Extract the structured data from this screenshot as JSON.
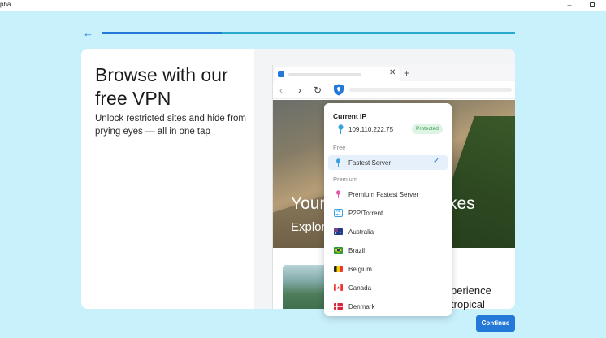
{
  "window": {
    "title": "pha"
  },
  "progress": {
    "value": 0.29
  },
  "intro": {
    "headline": "Browse with our free VPN",
    "subtext": "Unlock restricted sites and hide from prying eyes — all in one tap"
  },
  "browser_mock": {
    "hero_headline_left": "Your",
    "hero_headline_right": "kes",
    "hero_subline": "Explor",
    "snippet_line1": "perience",
    "snippet_line2": "tropical"
  },
  "vpn_menu": {
    "current_ip_label": "Current IP",
    "ip_address": "109.110.222.75",
    "status_badge": "Protected",
    "free_label": "Free",
    "free_items": [
      {
        "label": "Fastest Server",
        "icon": "pin-blue-icon",
        "selected": true
      }
    ],
    "premium_label": "Premium",
    "premium_items": [
      {
        "label": "Premium Fastest Server",
        "icon": "pin-pink-icon"
      },
      {
        "label": "P2P/Torrent",
        "icon": "p2p-icon"
      },
      {
        "label": "Australia",
        "icon": "flag-australia-icon"
      },
      {
        "label": "Brazil",
        "icon": "flag-brazil-icon"
      },
      {
        "label": "Belgium",
        "icon": "flag-belgium-icon"
      },
      {
        "label": "Canada",
        "icon": "flag-canada-icon"
      },
      {
        "label": "Denmark",
        "icon": "flag-denmark-icon"
      }
    ]
  },
  "actions": {
    "continue_label": "Continue"
  },
  "colors": {
    "accent": "#2378d8",
    "background": "#c9f1fc",
    "protected_green": "#3b9b55"
  }
}
